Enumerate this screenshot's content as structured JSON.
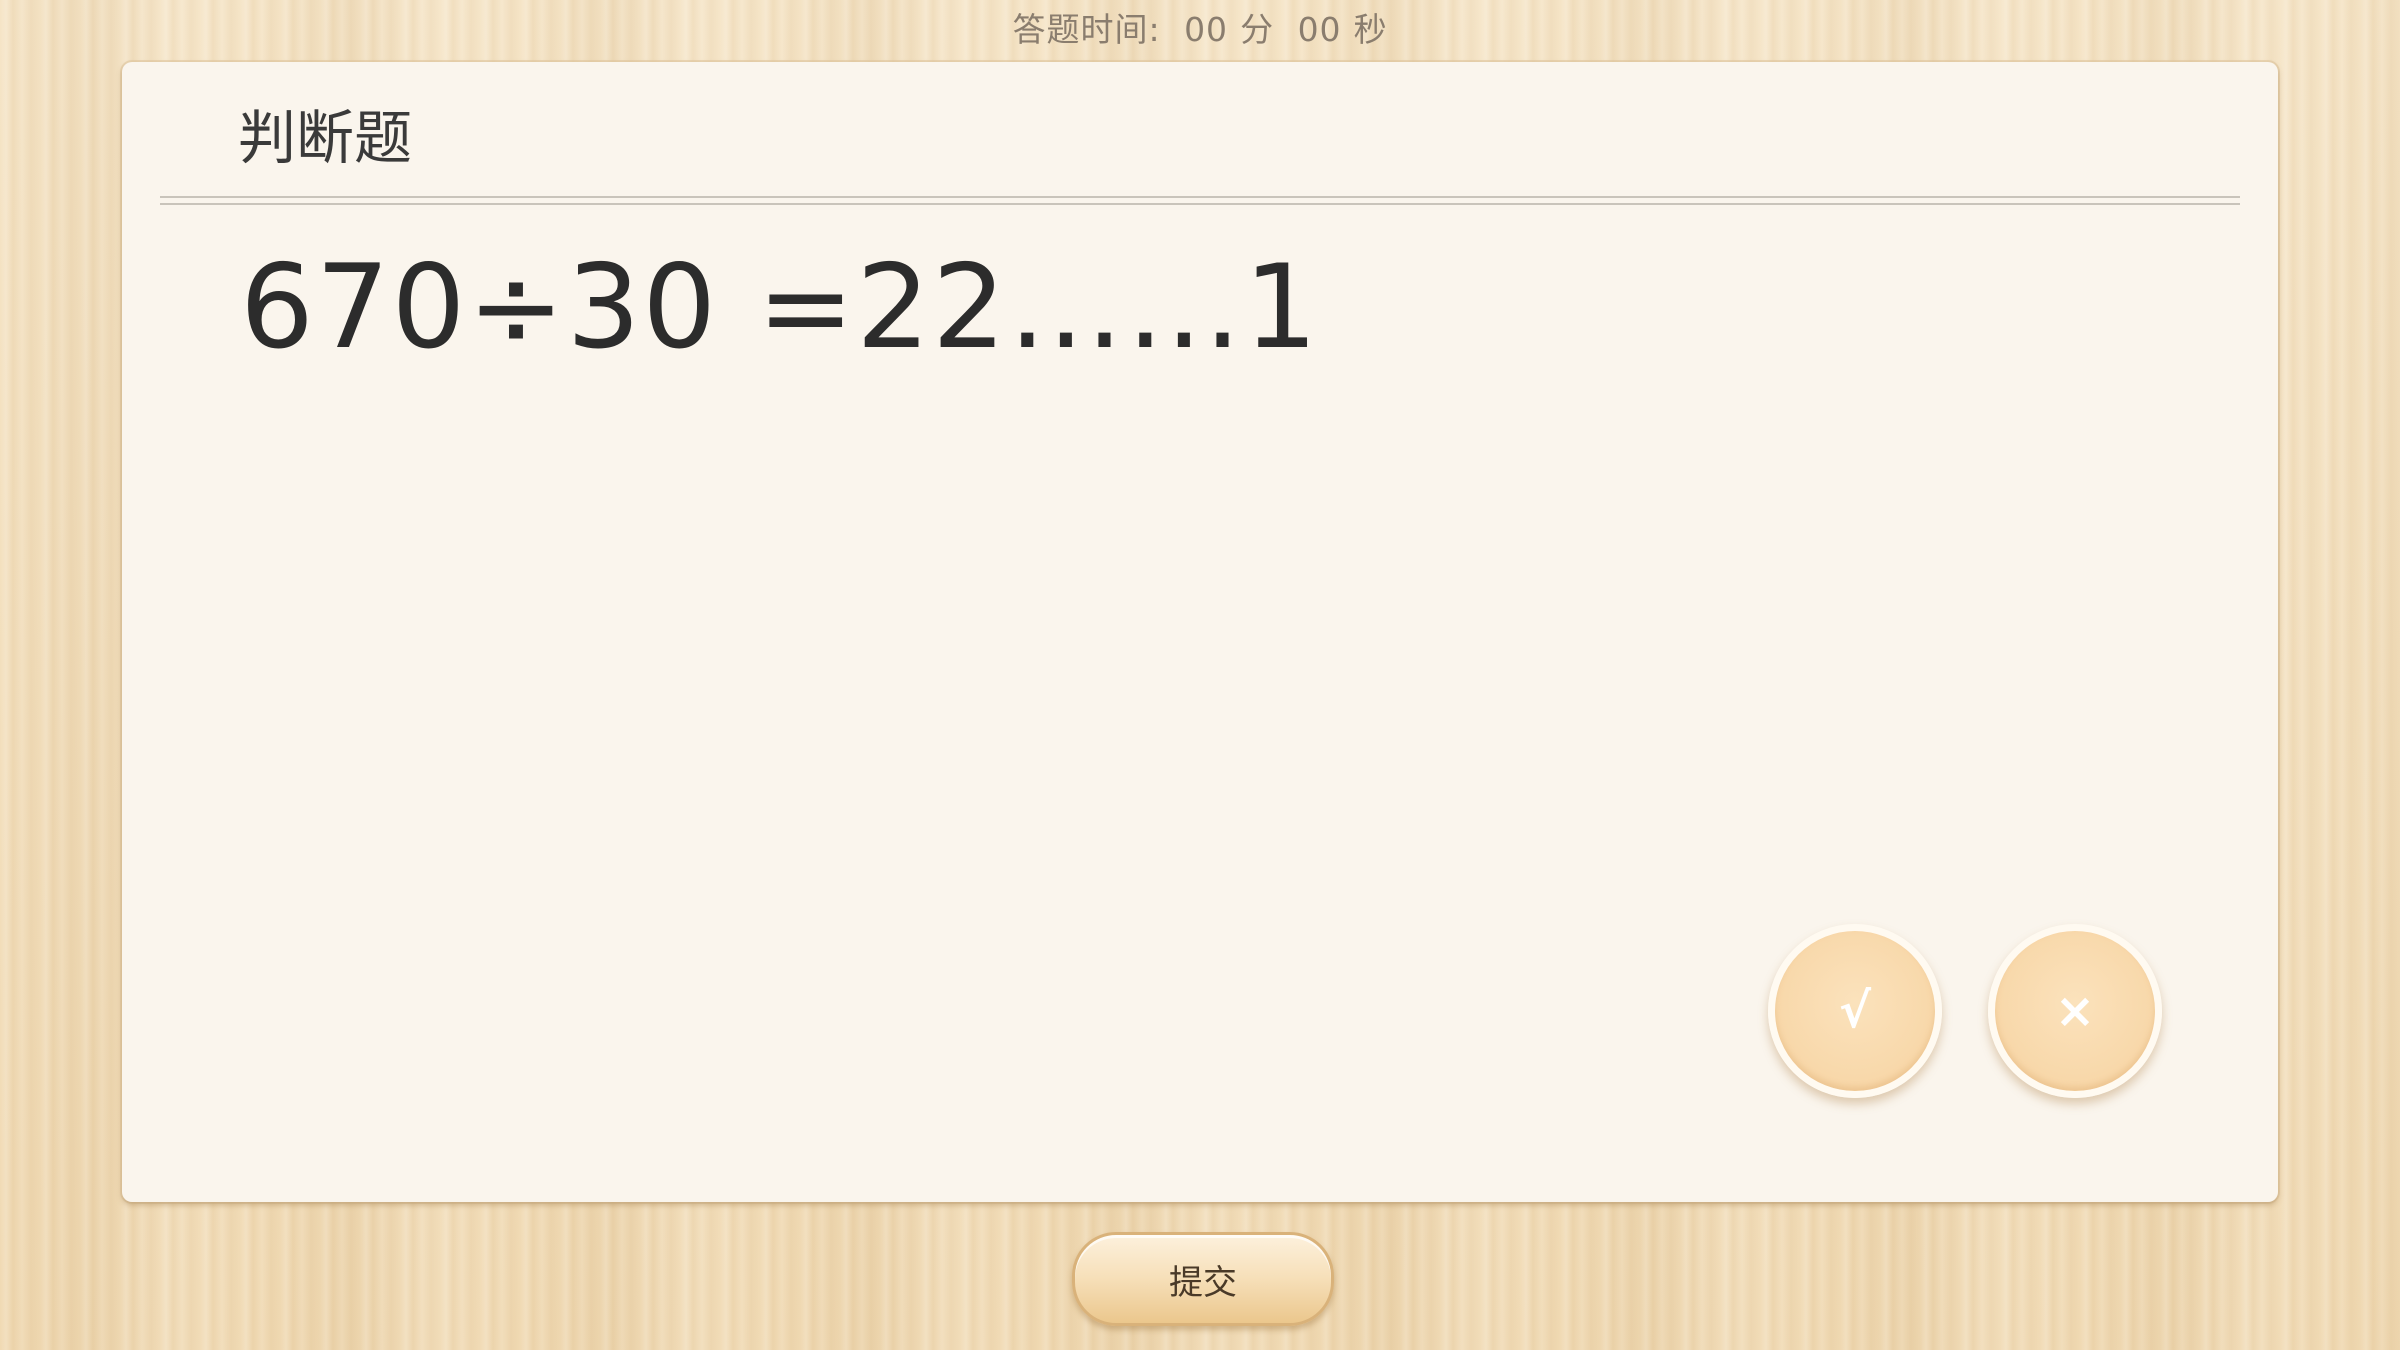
{
  "timer": {
    "label": "答题时间:",
    "minutes": "00",
    "minutes_unit": "分",
    "seconds": "00",
    "seconds_unit": "秒"
  },
  "card": {
    "title": "判断题",
    "question": "670÷30 =22……1"
  },
  "answers": {
    "true_label": "√",
    "false_label": "×"
  },
  "submit_label": "提交",
  "colors": {
    "background": "#f3dfbd",
    "card": "#faf5ed",
    "answer_button": "#f8d8aa",
    "text": "#2c2c2c"
  }
}
